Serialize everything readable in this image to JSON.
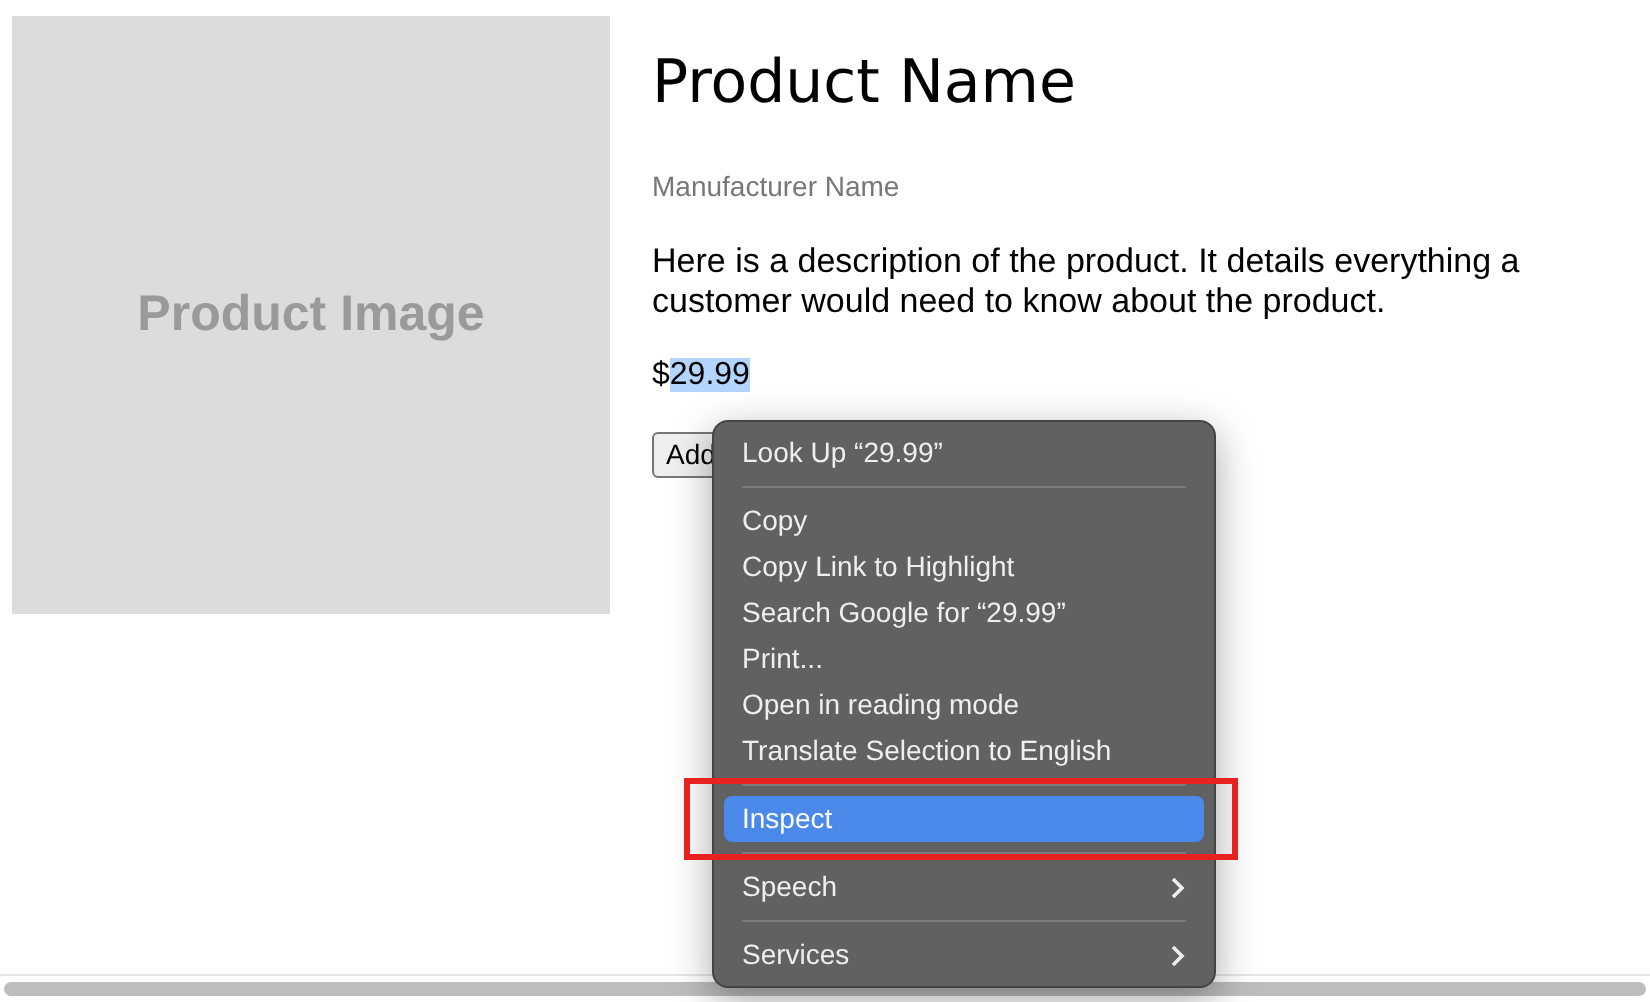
{
  "product": {
    "image_label": "Product Image",
    "name": "Product Name",
    "manufacturer": "Manufacturer Name",
    "description": "Here is a description of the product. It details everything a customer would need to know about the product.",
    "price_currency": "$",
    "price_amount": "29.99",
    "price_highlighted": true,
    "button": "Add"
  },
  "context_menu": {
    "items": [
      {
        "kind": "item",
        "label": "Look Up “29.99”",
        "selected": false,
        "submenu": false,
        "outlined": false
      },
      {
        "kind": "separator"
      },
      {
        "kind": "item",
        "label": "Copy",
        "selected": false,
        "submenu": false,
        "outlined": false
      },
      {
        "kind": "item",
        "label": "Copy Link to Highlight",
        "selected": false,
        "submenu": false,
        "outlined": false
      },
      {
        "kind": "item",
        "label": "Search Google for “29.99”",
        "selected": false,
        "submenu": false,
        "outlined": false
      },
      {
        "kind": "item",
        "label": "Print...",
        "selected": false,
        "submenu": false,
        "outlined": false
      },
      {
        "kind": "item",
        "label": "Open in reading mode",
        "selected": false,
        "submenu": false,
        "outlined": false
      },
      {
        "kind": "item",
        "label": "Translate Selection to English",
        "selected": false,
        "submenu": false,
        "outlined": false
      },
      {
        "kind": "separator"
      },
      {
        "kind": "item",
        "label": "Inspect",
        "selected": true,
        "submenu": false,
        "outlined": true
      },
      {
        "kind": "separator"
      },
      {
        "kind": "item",
        "label": "Speech",
        "selected": false,
        "submenu": true,
        "outlined": false
      },
      {
        "kind": "separator"
      },
      {
        "kind": "item",
        "label": "Services",
        "selected": false,
        "submenu": true,
        "outlined": false
      }
    ]
  }
}
